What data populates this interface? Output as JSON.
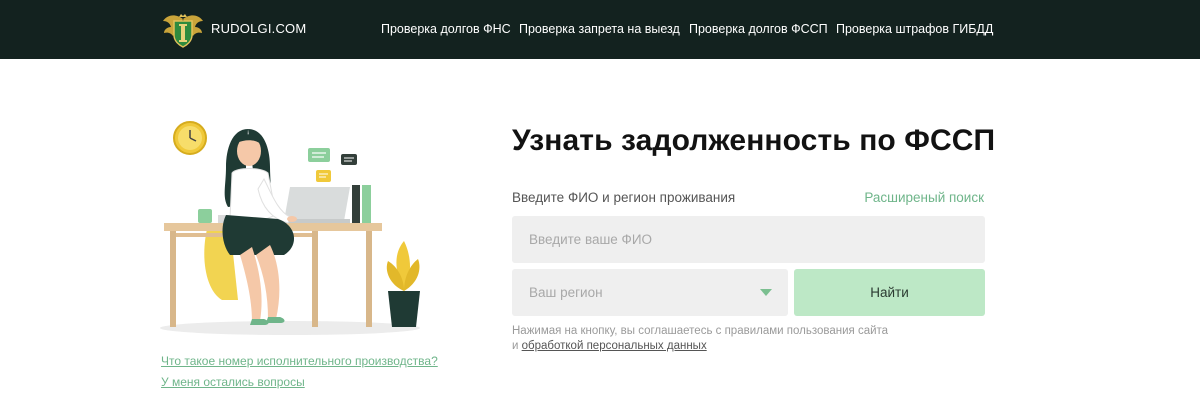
{
  "header": {
    "brand": "RUDOLGI.COM",
    "nav": [
      {
        "label": "Проверка долгов ФНС"
      },
      {
        "label": "Проверка запрета на выезд"
      },
      {
        "label": "Проверка долгов ФССП"
      },
      {
        "label": "Проверка штрафов ГИБДД"
      }
    ]
  },
  "illustration": {
    "icon": "woman-at-desk-illustration"
  },
  "help_links": [
    {
      "label": "Что такое номер исполнительного производства?"
    },
    {
      "label": "У меня остались вопросы"
    }
  ],
  "form": {
    "title": "Узнать задолженность по ФССП",
    "label": "Введите ФИО и регион проживания",
    "advanced_search": "Расширеный поиск",
    "fio_placeholder": "Введите ваше ФИО",
    "region_value": "Ваш регион",
    "submit_label": "Найти",
    "disclaimer_text": "Нажимая на кнопку, вы соглашаетесь с правилами пользования сайта и ",
    "disclaimer_link": "обработкой персональных данных"
  },
  "colors": {
    "header_bg": "#13221f",
    "accent_green": "#6fb58a",
    "button_bg": "#bde8c6",
    "input_bg": "#efefef"
  }
}
